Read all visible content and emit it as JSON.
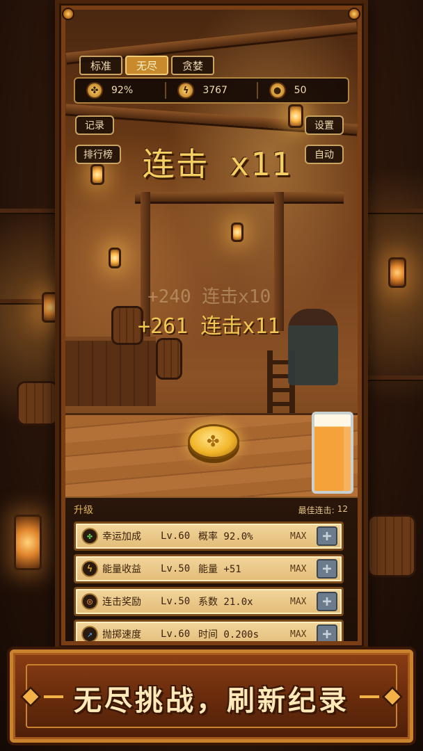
{
  "tabs": [
    {
      "label": "标准",
      "active": false
    },
    {
      "label": "无尽",
      "active": true
    },
    {
      "label": "贪婪",
      "active": false
    }
  ],
  "stats": {
    "luck": {
      "icon": "clover-icon",
      "value": "92%"
    },
    "energy": {
      "icon": "lightning-icon",
      "value": "3767"
    },
    "coins": {
      "icon": "coin-icon",
      "value": "50"
    }
  },
  "buttons": {
    "record": "记录",
    "leaderboard": "排行榜",
    "settings": "设置",
    "auto": "自动"
  },
  "combo": {
    "title": "连击 x11",
    "float_faded": "+240 连击x10",
    "float_active": "+261 连击x11"
  },
  "upgrades": {
    "title": "升级",
    "best_label": "最佳连击:",
    "best_value": "12",
    "items": [
      {
        "icon": "clover-icon",
        "name": "幸运加成",
        "level": "Lv.60",
        "desc": "概率 92.0%",
        "status": "MAX"
      },
      {
        "icon": "lightning-icon",
        "name": "能量收益",
        "level": "Lv.50",
        "desc": "能量 +51",
        "status": "MAX"
      },
      {
        "icon": "target-icon",
        "name": "连击奖励",
        "level": "Lv.50",
        "desc": "系数 21.0x",
        "status": "MAX"
      },
      {
        "icon": "arrow-icon",
        "name": "抛掷速度",
        "level": "Lv.60",
        "desc": "时间 0.200s",
        "status": "MAX"
      }
    ]
  },
  "banner": {
    "text": "无尽挑战，刷新纪录"
  },
  "colors": {
    "accent_gold": "#f6cf63",
    "frame_wood": "#7a3e14",
    "panel_parchment": "#f2d59b"
  }
}
